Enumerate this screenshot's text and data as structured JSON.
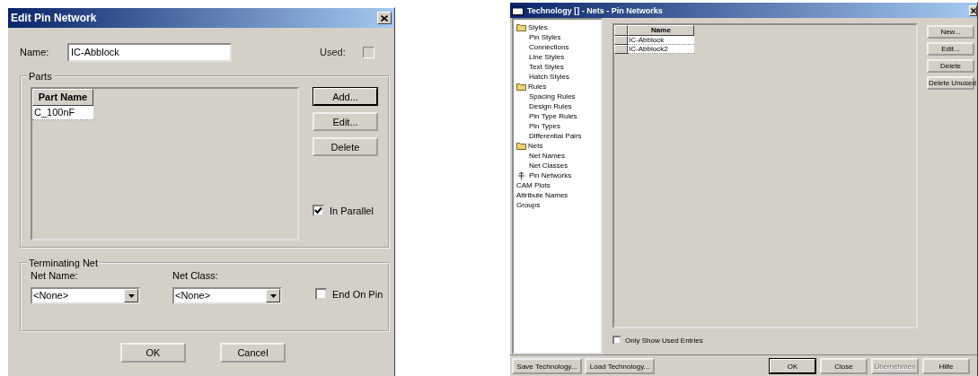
{
  "edit_dialog": {
    "title": "Edit Pin Network",
    "name_label": {
      "text": "Name:"
    },
    "name_value": "IC-Abblock",
    "used": {
      "label": "Used:",
      "checked": false
    },
    "parts": {
      "legend": "Parts",
      "column": "Part Name",
      "rows": [
        "C_100nF"
      ]
    },
    "part_buttons": [
      {
        "label": "Add...",
        "default": true
      },
      {
        "label": "Edit...",
        "default": false
      },
      {
        "label": "Delete",
        "default": false
      }
    ],
    "in_parallel": {
      "label": "In Parallel",
      "checked": true
    },
    "terminating_net": {
      "legend": "Terminating Net",
      "fields": [
        {
          "label": "Net Name:",
          "value": "<None>"
        },
        {
          "label": "Net Class:",
          "value": "<None>"
        }
      ],
      "end_on_pin": {
        "label": "End On Pin",
        "checked": false
      }
    },
    "buttons": [
      {
        "label": "OK",
        "default": false
      },
      {
        "label": "Cancel",
        "default": false
      }
    ]
  },
  "technology_dialog": {
    "title": "Technology [] - Nets - Pin Networks",
    "tree": [
      {
        "label": "Styles",
        "kind": "folder",
        "children": [
          {
            "label": "Pin Styles",
            "kind": "item"
          },
          {
            "label": "Connections",
            "kind": "item"
          },
          {
            "label": "Line Styles",
            "kind": "item"
          },
          {
            "label": "Text Styles",
            "kind": "item"
          },
          {
            "label": "Hatch Styles",
            "kind": "item"
          }
        ]
      },
      {
        "label": "Rules",
        "kind": "folder",
        "children": [
          {
            "label": "Spacing Rules",
            "kind": "item"
          },
          {
            "label": "Design Rules",
            "kind": "item"
          },
          {
            "label": "Pin Type Rules",
            "kind": "item"
          },
          {
            "label": "Pin Types",
            "kind": "item"
          },
          {
            "label": "Differential Pairs",
            "kind": "item"
          }
        ]
      },
      {
        "label": "Nets",
        "kind": "folder",
        "children": [
          {
            "label": "Net Names",
            "kind": "item"
          },
          {
            "label": "Net Classes",
            "kind": "item"
          },
          {
            "label": "Pin Networks",
            "kind": "network"
          }
        ]
      },
      {
        "label": "CAM Plots",
        "kind": "item"
      },
      {
        "label": "Attribute Names",
        "kind": "item"
      },
      {
        "label": "Groups",
        "kind": "item"
      }
    ],
    "table": {
      "column": "Name",
      "rows": [
        "IC-Abblock",
        "IC-Abblock2"
      ]
    },
    "side_buttons": [
      {
        "label": "New..."
      },
      {
        "label": "Edit..."
      },
      {
        "label": "Delete"
      },
      {
        "label": "Delete Unused"
      }
    ],
    "only_used": {
      "label": "Only Show Used Entries",
      "checked": false
    },
    "left_buttons": [
      {
        "label": "Save Technology..."
      },
      {
        "label": "Load Technology..."
      }
    ],
    "right_buttons": [
      {
        "label": "OK",
        "default": true,
        "disabled": false
      },
      {
        "label": "Close",
        "default": false,
        "disabled": false
      },
      {
        "label": "Übernehmen",
        "default": false,
        "disabled": true
      },
      {
        "label": "Hilfe",
        "default": false,
        "disabled": false
      }
    ]
  }
}
